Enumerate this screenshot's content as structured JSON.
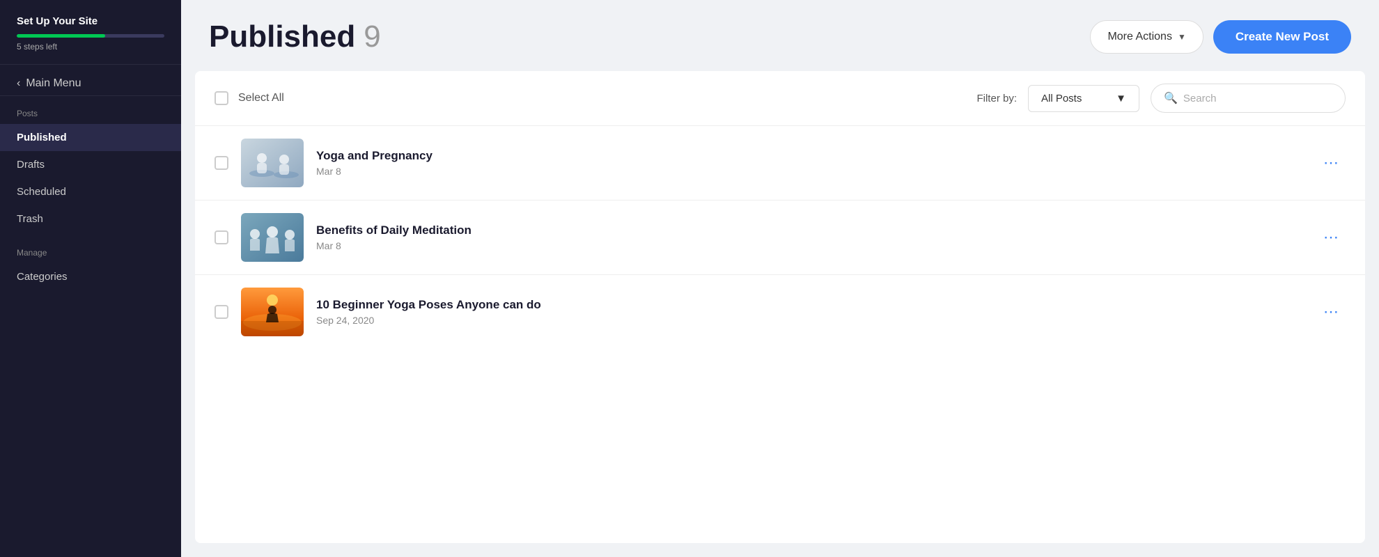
{
  "sidebar": {
    "setup_title": "Set Up Your Site",
    "steps_left": "5 steps left",
    "progress_pct": 60,
    "main_menu_label": "Main Menu",
    "posts_section_label": "Posts",
    "nav_items": [
      {
        "id": "published",
        "label": "Published",
        "active": true
      },
      {
        "id": "drafts",
        "label": "Drafts",
        "active": false
      },
      {
        "id": "scheduled",
        "label": "Scheduled",
        "active": false
      },
      {
        "id": "trash",
        "label": "Trash",
        "active": false
      }
    ],
    "manage_label": "Manage",
    "manage_items": [
      {
        "id": "categories",
        "label": "Categories"
      }
    ]
  },
  "header": {
    "page_title": "Published",
    "post_count": "9",
    "more_actions_label": "More Actions",
    "create_post_label": "Create New Post"
  },
  "toolbar": {
    "select_all_label": "Select All",
    "filter_label": "Filter by:",
    "filter_value": "All Posts",
    "search_placeholder": "Search"
  },
  "posts": [
    {
      "id": "post-1",
      "title": "Yoga and Pregnancy",
      "date": "Mar 8",
      "thumb_color_a": "#c9d6df",
      "thumb_color_b": "#8fa8c0"
    },
    {
      "id": "post-2",
      "title": "Benefits of Daily Meditation",
      "date": "Mar 8",
      "thumb_color_a": "#7ba7bc",
      "thumb_color_b": "#4a7a9b"
    },
    {
      "id": "post-3",
      "title": "10 Beginner Yoga Poses Anyone can do",
      "date": "Sep 24, 2020",
      "thumb_color_a": "#f7971e",
      "thumb_color_b": "#e85d04"
    }
  ],
  "colors": {
    "accent": "#3b82f6",
    "sidebar_bg": "#1a1a2e",
    "progress_green": "#00c853"
  }
}
